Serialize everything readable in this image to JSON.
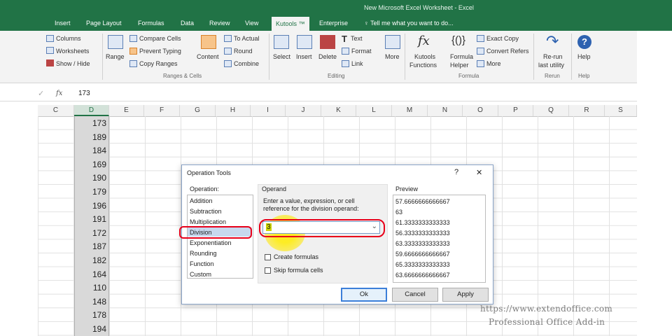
{
  "window": {
    "title": "New Microsoft Excel Worksheet - Excel"
  },
  "tabs": [
    "Insert",
    "Page Layout",
    "Formulas",
    "Data",
    "Review",
    "View",
    "Kutools ™",
    "Enterprise"
  ],
  "tell_me": "Tell me what you want to do...",
  "ribbon": {
    "left_items": [
      "Columns",
      "Worksheets",
      "Show / Hide"
    ],
    "range": "Range",
    "ranges_items": [
      "Compare Cells",
      "Prevent Typing",
      "Copy Ranges"
    ],
    "content": "Content",
    "ranges_items2": [
      "To Actual",
      "Round",
      "Combine"
    ],
    "ranges_cells_group": "Ranges & Cells",
    "select": "Select",
    "insert": "Insert",
    "delete": "Delete",
    "editing_items": [
      "Text",
      "Format",
      "Link"
    ],
    "more": "More",
    "editing_group": "Editing",
    "kutools_functions": [
      "Kutools",
      "Functions"
    ],
    "formula_helper": [
      "Formula",
      "Helper"
    ],
    "formula_items": [
      "Exact Copy",
      "Convert Refers",
      "More"
    ],
    "formula_group": "Formula",
    "rerun": [
      "Re-run",
      "last utility"
    ],
    "rerun_group": "Rerun",
    "help": "Help",
    "help_group": "Help"
  },
  "formula_bar": {
    "fx": "fx",
    "value": "173"
  },
  "columns": [
    "C",
    "D",
    "E",
    "F",
    "G",
    "H",
    "I",
    "J",
    "K",
    "L",
    "M",
    "N",
    "O",
    "P",
    "Q",
    "R",
    "S"
  ],
  "column_d_values": [
    "173",
    "189",
    "184",
    "169",
    "190",
    "179",
    "196",
    "191",
    "172",
    "187",
    "182",
    "164",
    "110",
    "148",
    "178",
    "194"
  ],
  "dialog": {
    "title": "Operation Tools",
    "help": "?",
    "close": "✕",
    "operation_label": "Operation:",
    "operations": [
      "Addition",
      "Subtraction",
      "Multiplication",
      "Division",
      "Exponentiation",
      "Rounding",
      "Function",
      "Custom"
    ],
    "selected_operation": "Division",
    "operand_label": "Operand",
    "operand_hint_1": "Enter a value, expression, or cell",
    "operand_hint_2": "reference for the division operand:",
    "operand_value": "3",
    "create_formulas": "Create formulas",
    "skip_formula_cells": "Skip formula cells",
    "preview_label": "Preview",
    "preview_values": [
      "57.6666666666667",
      "63",
      "61.3333333333333",
      "56.3333333333333",
      "63.3333333333333",
      "59.6666666666667",
      "65.3333333333333",
      "63.6666666666667"
    ],
    "ok": "Ok",
    "cancel": "Cancel",
    "apply": "Apply"
  },
  "watermark": {
    "url": "https://www.extendoffice.com",
    "tagline": "Professional Office Add-in"
  },
  "colors": {
    "excel_green": "#217346",
    "annotation_red": "#e8001a",
    "highlight_yellow": "#ffec00"
  }
}
